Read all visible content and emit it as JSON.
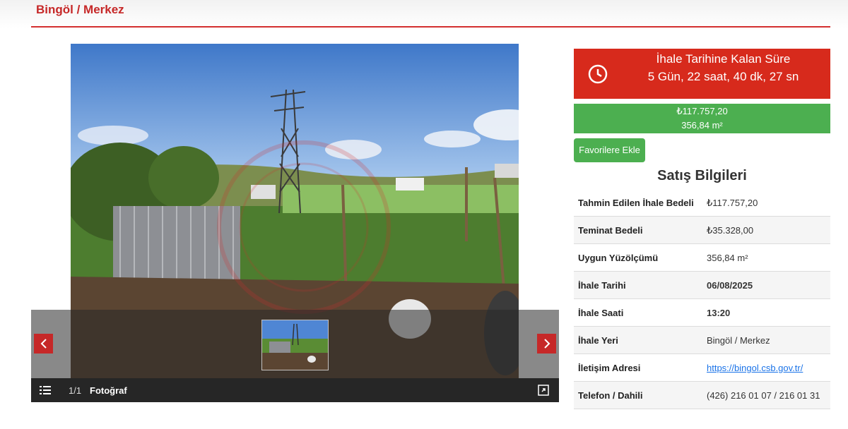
{
  "header": {
    "breadcrumb": "Bingöl / Merkez"
  },
  "gallery": {
    "counter": "1/1",
    "label": "Fotoğraf",
    "prev_icon": "chevron-left-icon",
    "next_icon": "chevron-right-icon",
    "list_icon": "list-icon",
    "expand_icon": "expand-icon"
  },
  "countdown": {
    "title": "İhale Tarihine Kalan Süre",
    "value": "5 Gün, 22 saat, 40 dk, 27 sn",
    "icon": "clock-icon"
  },
  "price": {
    "amount": "₺117.757,20",
    "area": "356,84 m²"
  },
  "favorite_button": "Favorilere Ekle",
  "sales_info": {
    "title": "Satış Bilgileri",
    "rows": [
      {
        "key": "Tahmin Edilen İhale Bedeli",
        "value": "₺117.757,20"
      },
      {
        "key": "Teminat Bedeli",
        "value": "₺35.328,00"
      },
      {
        "key": "Uygun Yüzölçümü",
        "value": "356,84 m²"
      },
      {
        "key": "İhale Tarihi",
        "value": "06/08/2025"
      },
      {
        "key": "İhale Saati",
        "value": "13:20"
      },
      {
        "key": "İhale Yeri",
        "value": "Bingöl / Merkez"
      },
      {
        "key": "İletişim Adresi",
        "value": "https://bingol.csb.gov.tr/"
      },
      {
        "key": "Telefon / Dahili",
        "value": "(426) 216 01 07 / 216 01 31"
      }
    ]
  },
  "colors": {
    "brand_red": "#d72a1c",
    "success_green": "#4caf50"
  }
}
